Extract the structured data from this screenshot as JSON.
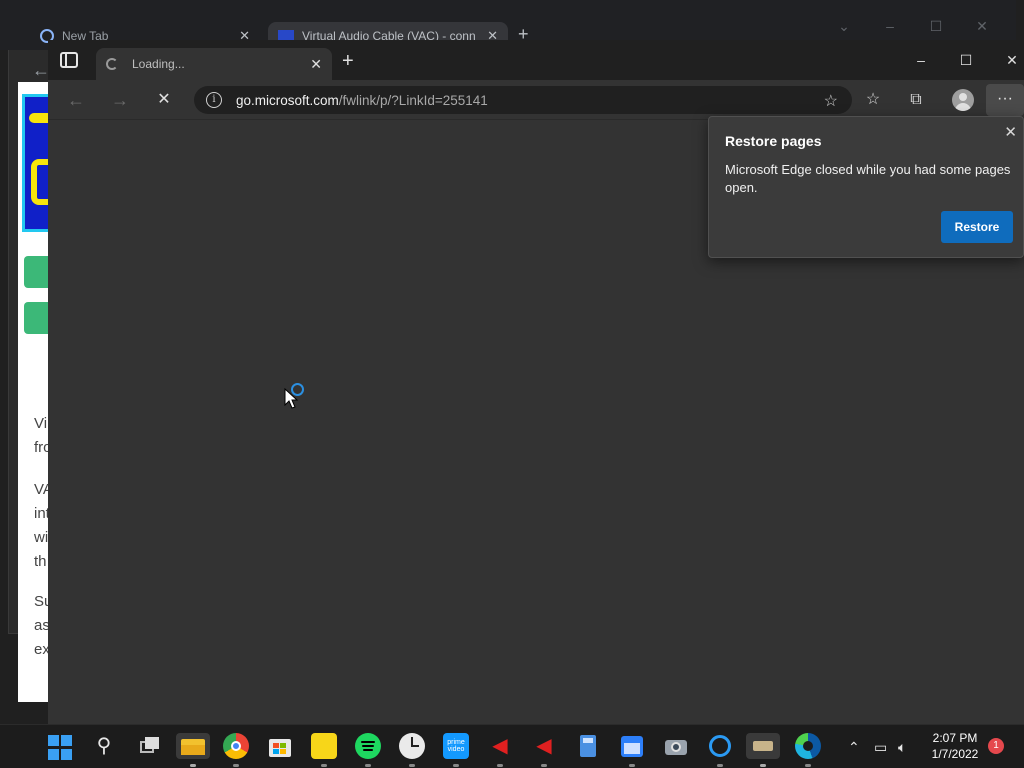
{
  "background_browser": {
    "tabs": [
      {
        "label": "New Tab"
      },
      {
        "label": "Virtual Audio Cable (VAC) - conn"
      }
    ],
    "page_text_fragments": [
      "Vi",
      "fro",
      "VA",
      "int",
      "wi",
      "th",
      "Su",
      "as",
      "ex"
    ]
  },
  "edge": {
    "tab": {
      "label": "Loading..."
    },
    "url": {
      "host": "go.microsoft.com",
      "path": "/fwlink/p/?LinkId=255141"
    }
  },
  "restore_popup": {
    "title": "Restore pages",
    "message": "Microsoft Edge closed while you had some pages open.",
    "button_label": "Restore"
  },
  "taskbar": {
    "apps": [
      "start",
      "search",
      "task-view",
      "file-explorer",
      "chrome",
      "microsoft-store",
      "sticky-notes",
      "spotify",
      "clock",
      "prime-video",
      "audio-app-1",
      "audio-app-2",
      "calculator",
      "calendar",
      "camera",
      "cortana",
      "app-generic",
      "edge"
    ],
    "clock_time": "2:07 PM",
    "clock_date": "1/7/2022",
    "notification_count": "1"
  },
  "colors": {
    "edge_bg": "#333333",
    "accent": "#0f6cbd",
    "taskbar": "#1c1c1c"
  }
}
